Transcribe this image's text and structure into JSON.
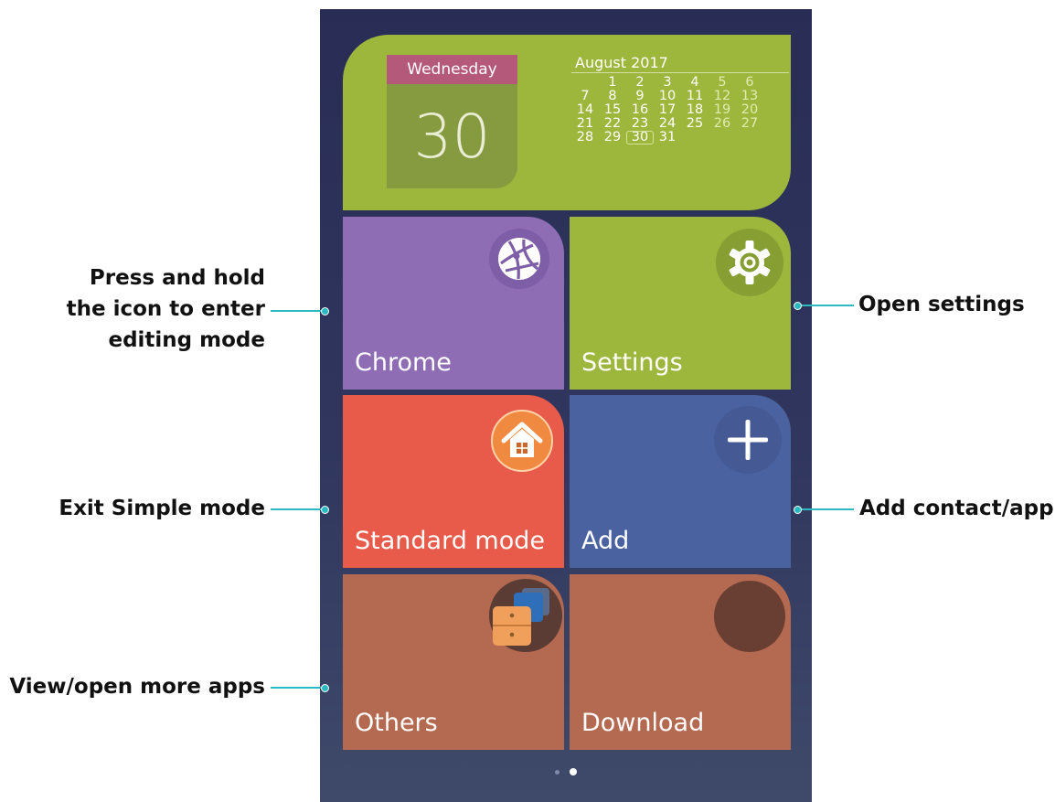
{
  "calendar": {
    "weekday": "Wednesday",
    "day": "30",
    "month_title": "August 2017",
    "rows": [
      [
        "",
        "1",
        "2",
        "3",
        "4",
        "5",
        "6"
      ],
      [
        "7",
        "8",
        "9",
        "10",
        "11",
        "12",
        "13"
      ],
      [
        "14",
        "15",
        "16",
        "17",
        "18",
        "19",
        "20"
      ],
      [
        "21",
        "22",
        "23",
        "24",
        "25",
        "26",
        "27"
      ],
      [
        "28",
        "29",
        "30",
        "31",
        "",
        "",
        ""
      ]
    ],
    "today": "30"
  },
  "tiles": {
    "chrome": {
      "label": "Chrome",
      "icon": "browser-globe-icon",
      "color": "#8f6db4"
    },
    "settings": {
      "label": "Settings",
      "icon": "gear-icon",
      "color": "#9db63c"
    },
    "standard_mode": {
      "label": "Standard mode",
      "icon": "home-icon",
      "color": "#e85a4a"
    },
    "add": {
      "label": "Add",
      "icon": "plus-icon",
      "color": "#4b62a0"
    },
    "others": {
      "label": "Others",
      "icon": "folder-stack-icon",
      "color": "#b46a50"
    },
    "download": {
      "label": "Download",
      "icon": "circle-icon",
      "color": "#b46a50"
    }
  },
  "page_indicator": {
    "pages": 2,
    "active": 2
  },
  "callouts": {
    "press_hold": "Press and hold\nthe icon to enter\nediting mode",
    "open_settings": "Open settings",
    "exit_simple": "Exit Simple mode",
    "add_contact": "Add contact/app",
    "view_more": "View/open more apps"
  },
  "colors": {
    "accent_line": "#2bbac2",
    "background": "#292d56"
  }
}
